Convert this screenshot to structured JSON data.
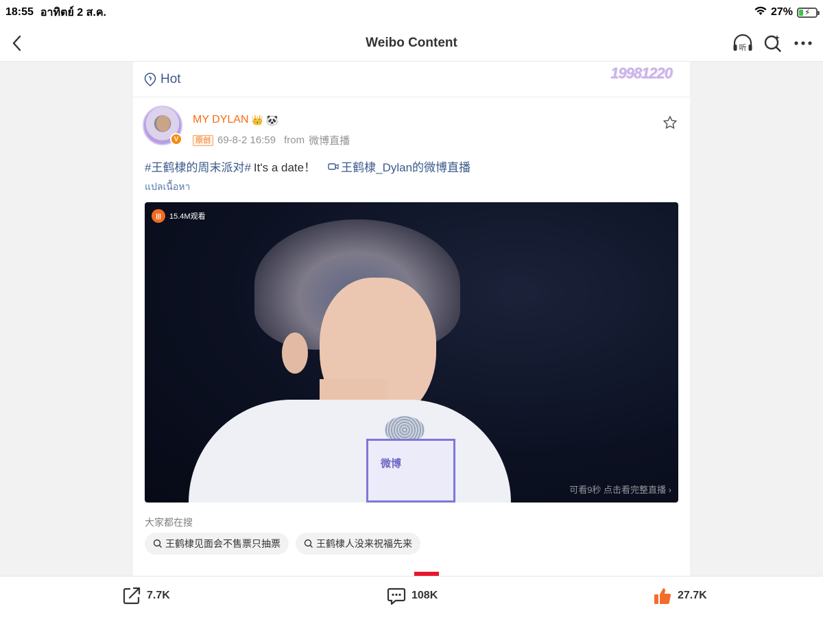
{
  "status_bar": {
    "time": "18:55",
    "date": "อาทิตย์ 2 ส.ค.",
    "battery_percent_label": "27%",
    "battery_level": 0.27,
    "wifi_icon": "wifi-icon",
    "charging": true
  },
  "nav": {
    "title": "Weibo Content",
    "back_icon": "chevron-left-icon",
    "listen_icon": "headphones-listen-icon",
    "listen_label": "听",
    "search_icon": "search-sparkle-icon",
    "more_icon": "more-dots-icon"
  },
  "card": {
    "hot_label": "Hot",
    "watermark": "19981220",
    "post": {
      "username": "MY DYLAN",
      "username_badges": [
        "👑",
        "🐼"
      ],
      "verified_icon": "verified-v-icon",
      "original_tag": "原创",
      "timestamp": "69-8-2 16:59",
      "source_prefix": "from",
      "source": "微博直播",
      "text": {
        "hashtag": "#王鹤棣的周末派对#",
        "body": "It's a date！",
        "live_link": "王鹤棣_Dylan的微博直播"
      },
      "translate": "แปลเนื้อหา",
      "video": {
        "views": "15.4M观看",
        "hint": "可看9秒 点击看完整直播 ›",
        "mic_logo_text": "微博"
      }
    },
    "everyone_searching": {
      "title": "大家都在搜",
      "items": [
        "王鹤棣见面会不售票只抽票",
        "王鹤棣人没来祝福先来"
      ]
    }
  },
  "actions": {
    "repost_count": "7.7K",
    "comment_count": "108K",
    "like_count": "27.7K",
    "colors": {
      "like": "#f26d2b",
      "link": "#3b5a8c",
      "accent": "#f86d0e"
    }
  }
}
